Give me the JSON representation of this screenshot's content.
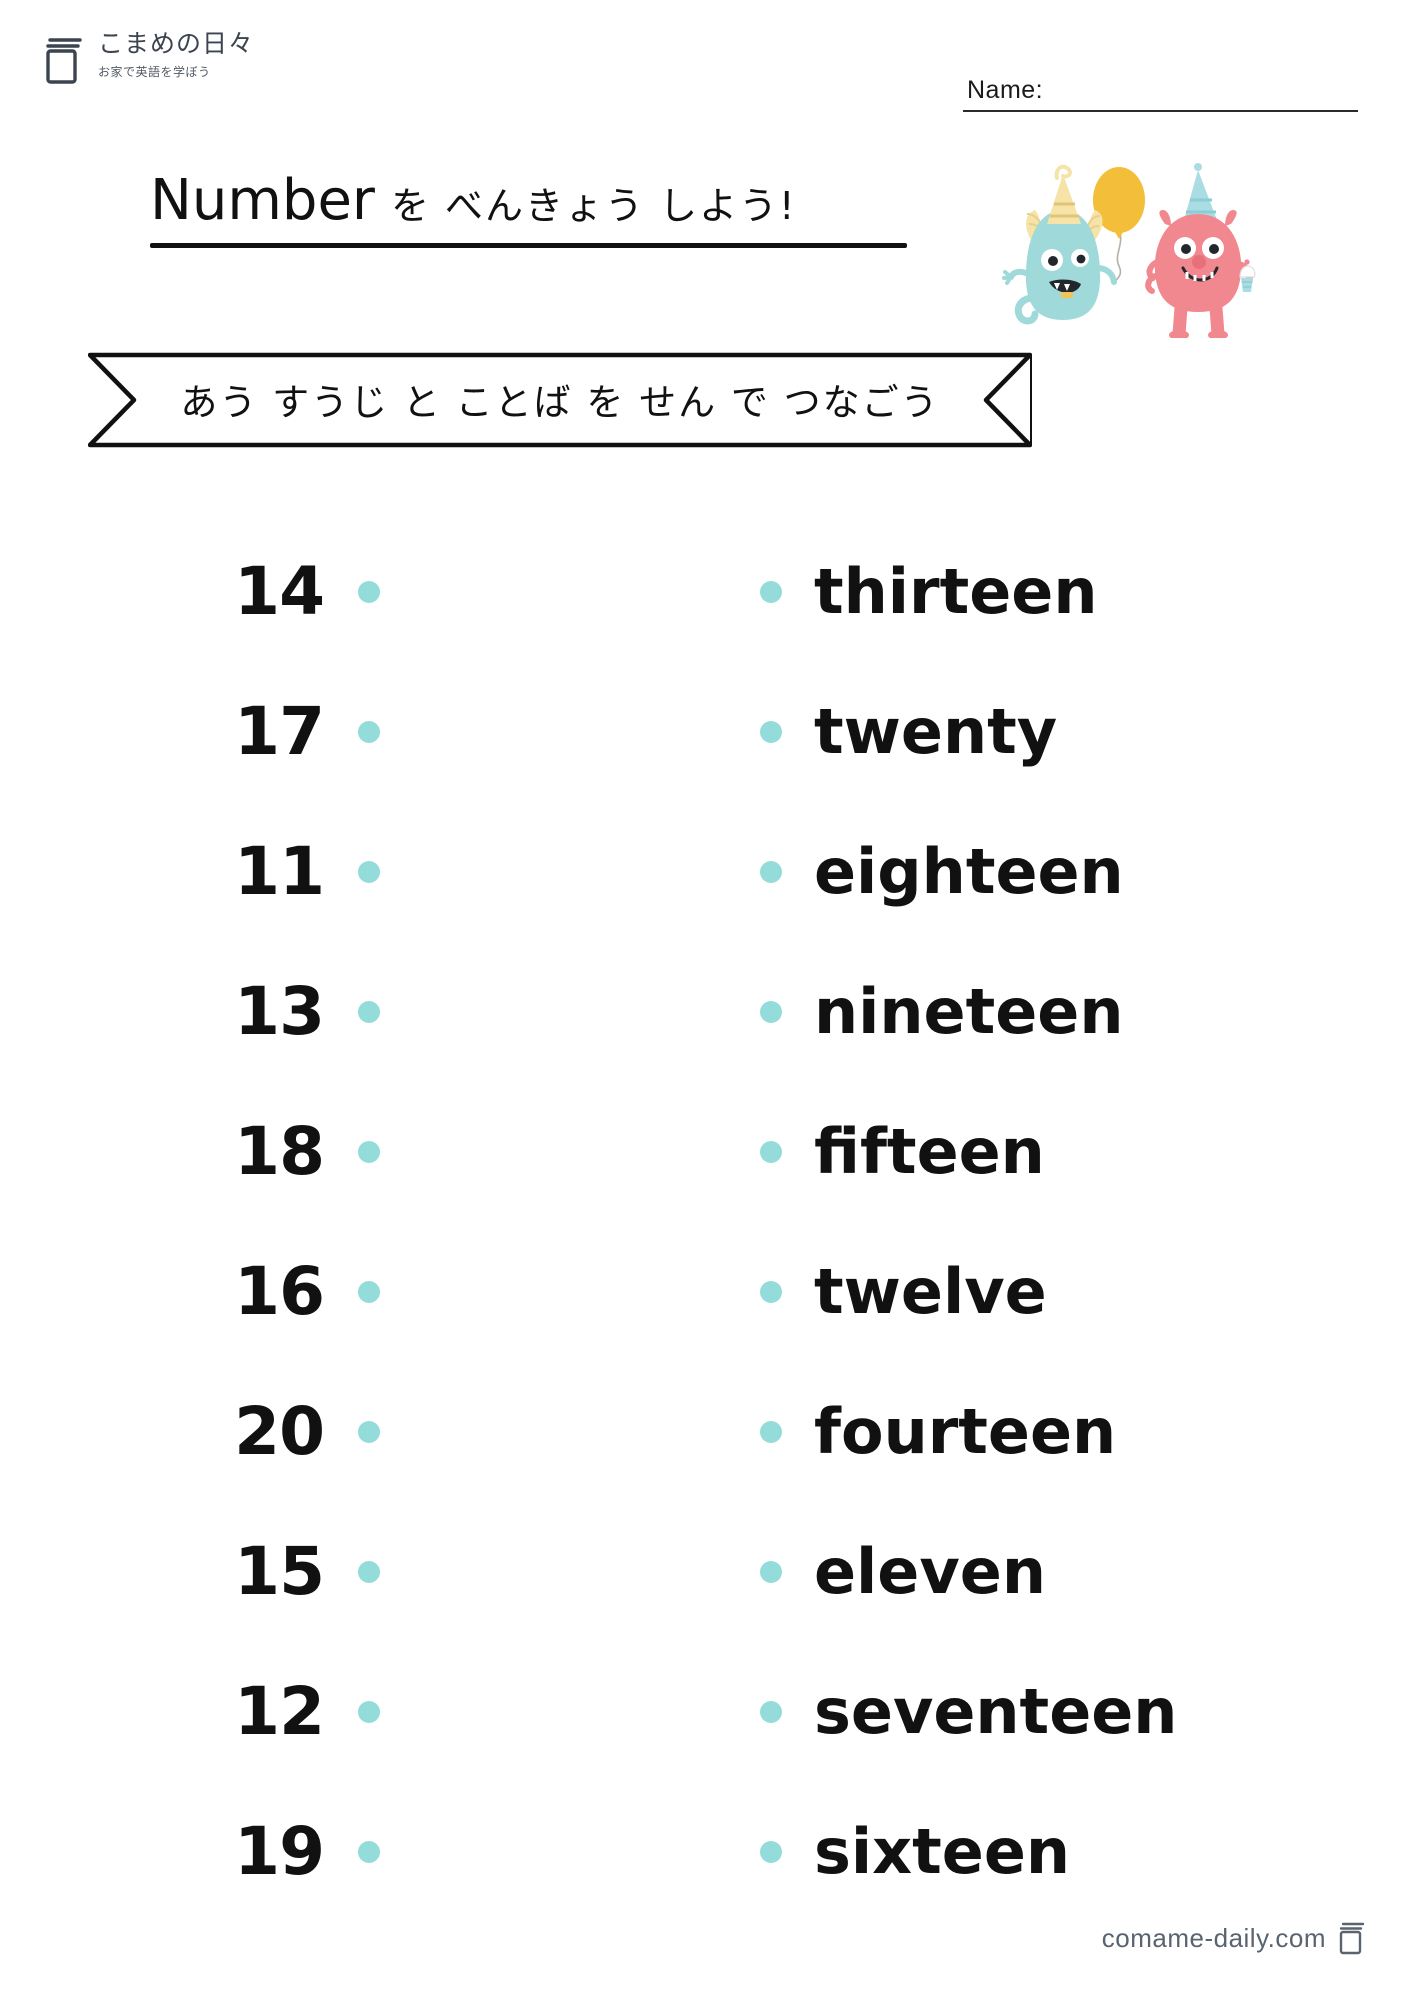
{
  "brand": {
    "name": "こまめの日々",
    "tagline": "お家で英語を学ぼう",
    "icon": "book-icon"
  },
  "header": {
    "name_label": "Name:"
  },
  "title": {
    "english": "Number",
    "japanese": "を べんきょう しよう!"
  },
  "banner": {
    "instruction": "あう すうじ と ことば を せん で つなごう"
  },
  "illustration": {
    "left_monster": "teal-monster-with-balloon",
    "left_monster_hat": "yellow-party-hat",
    "balloon": "yellow-balloon",
    "right_monster": "pink-monster-with-cupcake",
    "right_monster_hat": "blue-party-hat",
    "cupcake": "cupcake-icon"
  },
  "colors": {
    "dot": "#93dcd9",
    "ink": "#111111",
    "muted": "#5a6370",
    "monster_teal": "#9fd9da",
    "monster_pink": "#f1888f",
    "balloon_yellow": "#f3bf3a",
    "hat_yellow": "#f6e3a8",
    "hat_blue": "#a9dde3"
  },
  "match_rows": [
    {
      "number": "14",
      "word": "thirteen"
    },
    {
      "number": "17",
      "word": "twenty"
    },
    {
      "number": "11",
      "word": "eighteen"
    },
    {
      "number": "13",
      "word": "nineteen"
    },
    {
      "number": "18",
      "word": "fifteen"
    },
    {
      "number": "16",
      "word": "twelve"
    },
    {
      "number": "20",
      "word": "fourteen"
    },
    {
      "number": "15",
      "word": "eleven"
    },
    {
      "number": "12",
      "word": "seventeen"
    },
    {
      "number": "19",
      "word": "sixteen"
    }
  ],
  "footer": {
    "url": "comame-daily.com",
    "icon": "book-icon"
  }
}
